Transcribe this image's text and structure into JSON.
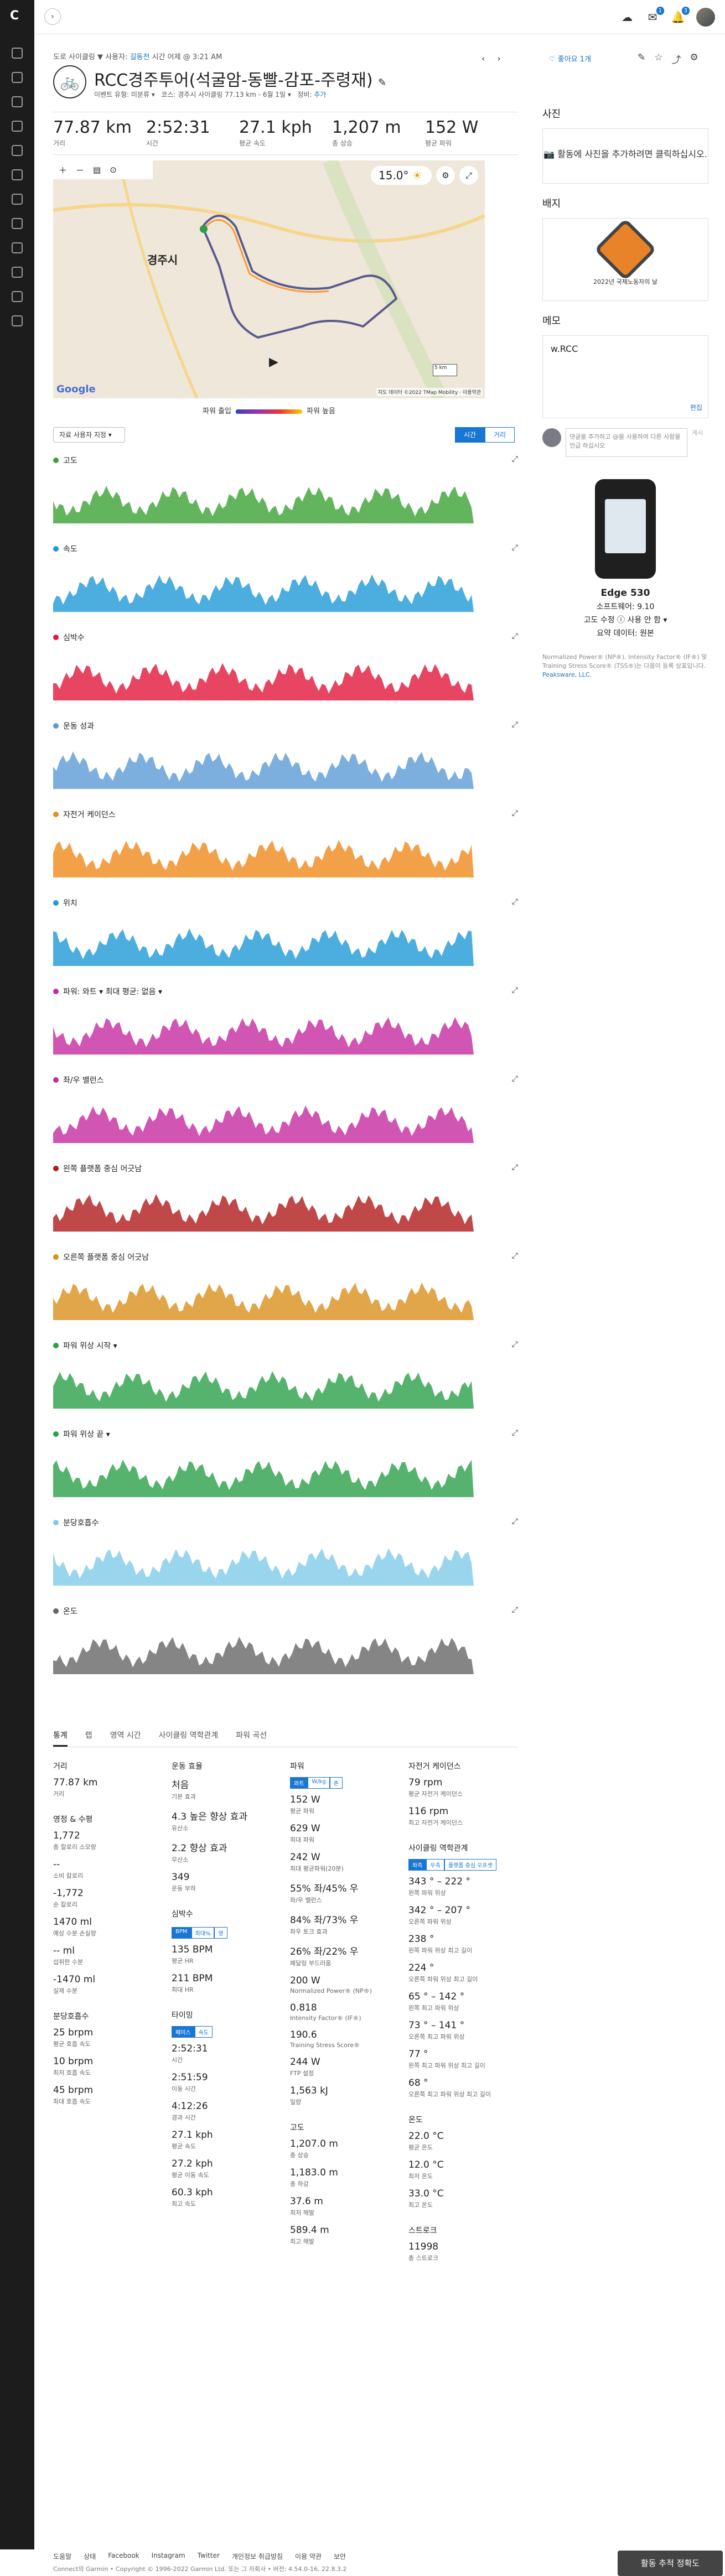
{
  "nav": {
    "logo": "C"
  },
  "breadcrumb": {
    "prefix": "도로 사이클링",
    "sep": "▼",
    "by": "사용자:",
    "user": "길동천",
    "when": "시간 어제 @ 3:21 AM"
  },
  "activity": {
    "title": "RCC경주투어(석굴암-동빨-감포-주령재)",
    "edit_icon": "pencil-icon",
    "sub_event": "이벤트 유형: 미분류 ▾",
    "sub_course": "코스: 경주시 사이클링 77.13 km - 6월 1일 ▾",
    "sub_privacy": "정비:",
    "sub_privacy_val": "추가",
    "like": "좋아요 1개"
  },
  "stats": [
    {
      "value": "77.87 km",
      "label": "거리"
    },
    {
      "value": "2:52:31",
      "label": "시간"
    },
    {
      "value": "27.1 kph",
      "label": "평균 속도"
    },
    {
      "value": "1,207 m",
      "label": "총 상승"
    },
    {
      "value": "152 W",
      "label": "평균 파워"
    }
  ],
  "map": {
    "city": "경주시",
    "deg": "15.0°",
    "credit": "지도 데이터 ©2022 TMap Mobility · 이용약관",
    "scale": "5 km",
    "google": "Google"
  },
  "legend": {
    "left": "파워 출입",
    "right": "파워 높음"
  },
  "overlay": {
    "label": "자료 사용자 지정 ▾"
  },
  "seg": {
    "a": "시간",
    "b": "거리"
  },
  "charts": [
    {
      "title": "고도",
      "color": "#3ba233"
    },
    {
      "title": "속도",
      "color": "#1e9ad6"
    },
    {
      "title": "심박수",
      "color": "#e2173c"
    },
    {
      "title": "운동 성과",
      "color": "#5b9bd5"
    },
    {
      "title": "자전거 케이던스",
      "color": "#ef8a1c"
    },
    {
      "title": "위치",
      "color": "#1e9ad6"
    },
    {
      "title": "파워: 와트 ▾   최대 평균: 없음 ▾",
      "color": "#c62aa0"
    },
    {
      "title": "좌/우 밸런스",
      "color": "#c62aa0"
    },
    {
      "title": "왼쪽 플랫폼 중심 어긋남",
      "color": "#b01a1a"
    },
    {
      "title": "오른쪽 플랫폼 중심 어긋남",
      "color": "#d9901b"
    },
    {
      "title": "파워 위상 시작 ▾",
      "color": "#2aa04a"
    },
    {
      "title": "파워 위상 끝 ▾",
      "color": "#2aa04a"
    },
    {
      "title": "분당호흡수",
      "color": "#7fcbe8"
    },
    {
      "title": "온도",
      "color": "#666666"
    }
  ],
  "tabs": [
    "통계",
    "랩",
    "영역 시간",
    "사이클링 역학관계",
    "파워 곡선"
  ],
  "col1": [
    {
      "h": "거리",
      "items": [
        {
          "v": "77.87 km",
          "l": "거리"
        }
      ]
    },
    {
      "h": "영정 & 수평",
      "items": [
        {
          "v": "1,772",
          "l": "총 칼로리 소모량"
        },
        {
          "v": "--",
          "l": "소비 칼로리"
        },
        {
          "v": "-1,772",
          "l": "순 칼로리"
        },
        {
          "v": "1470 ml",
          "l": "예상 수분 손실량"
        },
        {
          "v": "-- ml",
          "l": "섭취한 수분"
        },
        {
          "v": "-1470 ml",
          "l": "실제 수분"
        }
      ]
    },
    {
      "h": "분당호흡수",
      "items": [
        {
          "v": "25 brpm",
          "l": "평균 호흡 속도"
        },
        {
          "v": "10 brpm",
          "l": "최저 호흡 속도"
        },
        {
          "v": "45 brpm",
          "l": "최대 호흡 속도"
        }
      ]
    }
  ],
  "col2": [
    {
      "h": "운동 효율",
      "items": [
        {
          "v": "처음",
          "l": "기본 효과"
        },
        {
          "v": "4.3 높은 향상 효과",
          "l": "유산소"
        },
        {
          "v": "2.2 향상 효과",
          "l": "무산소"
        },
        {
          "v": "349",
          "l": "운동 부하"
        }
      ]
    },
    {
      "h": "심박수",
      "pill": [
        "BPM",
        "최대%",
        "영"
      ],
      "items": [
        {
          "v": "135 BPM",
          "l": "평균 HR"
        },
        {
          "v": "211 BPM",
          "l": "최대 HR"
        }
      ]
    },
    {
      "h": "타이밍",
      "pill": [
        "페이스",
        "속도"
      ],
      "items": [
        {
          "v": "2:52:31",
          "l": "시간"
        },
        {
          "v": "2:51:59",
          "l": "이동 시간"
        },
        {
          "v": "4:12:26",
          "l": "경과 시간"
        },
        {
          "v": "27.1 kph",
          "l": "평균 속도"
        },
        {
          "v": "27.2 kph",
          "l": "평균 이동 속도"
        },
        {
          "v": "60.3 kph",
          "l": "최고 속도"
        }
      ]
    }
  ],
  "col3": [
    {
      "h": "파워",
      "pill": [
        "와트",
        "W/kg",
        "존"
      ],
      "items": [
        {
          "v": "152 W",
          "l": "평균 파워"
        },
        {
          "v": "629 W",
          "l": "최대 파워"
        },
        {
          "v": "242 W",
          "l": "최대 평균파워(20분)"
        },
        {
          "v": "55% 좌/45% 우",
          "l": "좌/우 밸런스"
        },
        {
          "v": "84% 좌/73% 우",
          "l": "좌우 토크 효과"
        },
        {
          "v": "26% 좌/22% 우",
          "l": "페달링 부드러움"
        },
        {
          "v": "200 W",
          "l": "Normalized Power® (NP®)"
        },
        {
          "v": "0.818",
          "l": "Intensity Factor® (IF®)"
        },
        {
          "v": "190.6",
          "l": "Training Stress Score®"
        },
        {
          "v": "244 W",
          "l": "FTP 설정"
        },
        {
          "v": "1,563 kJ",
          "l": "일량"
        }
      ]
    },
    {
      "h": "고도",
      "items": [
        {
          "v": "1,207.0 m",
          "l": "총 상승"
        },
        {
          "v": "1,183.0 m",
          "l": "총 하강"
        },
        {
          "v": "37.6 m",
          "l": "최저 해발"
        },
        {
          "v": "589.4 m",
          "l": "최고 해발"
        }
      ]
    }
  ],
  "col4": [
    {
      "h": "자전거 케이던스",
      "items": [
        {
          "v": "79 rpm",
          "l": "평균 자전거 케이던스"
        },
        {
          "v": "116 rpm",
          "l": "최고 자전거 케이던스"
        }
      ]
    },
    {
      "h": "사이클링 역학관계",
      "pill": [
        "좌측",
        "우측",
        "플랫폼 중심 오프셋"
      ],
      "items": [
        {
          "v": "343 ° – 222 °",
          "l": "왼쪽 파워 위상"
        },
        {
          "v": "342 ° – 207 °",
          "l": "오른쪽 파워 위상"
        },
        {
          "v": "238 °",
          "l": "왼쪽 파워 위상 최고 길이"
        },
        {
          "v": "224 °",
          "l": "오른쪽 파워 위상 최고 길이"
        },
        {
          "v": "65 ° – 142 °",
          "l": "왼쪽 최고 파워 위상"
        },
        {
          "v": "73 ° – 141 °",
          "l": "오른쪽 최고 파워 위상"
        },
        {
          "v": "77 °",
          "l": "왼쪽 최고 파워 위상 최고 길이"
        },
        {
          "v": "68 °",
          "l": "오른쪽 최고 파워 위상 최고 길이"
        }
      ]
    },
    {
      "h": "온도",
      "items": [
        {
          "v": "22.0 °C",
          "l": "평균 온도"
        },
        {
          "v": "12.0 °C",
          "l": "최저 온도"
        },
        {
          "v": "33.0 °C",
          "l": "최고 온도"
        }
      ]
    },
    {
      "h": "스트로크",
      "items": [
        {
          "v": "11998",
          "l": "총 스트로크"
        }
      ]
    }
  ],
  "right": {
    "photos_h": "사진",
    "photos_cta": "활동에 사진을 추가하려면 클릭하십시오.",
    "badges_h": "배지",
    "badge_name": "2022년 국제노동자의 날",
    "memo_h": "메모",
    "memo_text": "w.RCC",
    "memo_edit": "편집",
    "comment_ph": "댓글을 추가하고 @을 사용하여 다른 사람을 언급 하십시오",
    "comment_btn": "게시",
    "device_name": "Edge 530",
    "device_sw": "소프트웨어: 9.10",
    "device_elev": "고도 수정 ⓘ 사용 안 함 ▾",
    "device_summary": "요약 데이터: 원본",
    "fine": "Normalized Power® (NP®), Intensity Factor® (IF®) 및 Training Stress Score® (TSS®)는 다음이 등록 상표입니다.",
    "fine_link": "Peaksware, LLC."
  },
  "footer": {
    "links": [
      "도움말",
      "상태",
      "Facebook",
      "Instagram",
      "Twitter",
      "개인정보 취급방침",
      "이용 약관",
      "보안"
    ],
    "copy": "Connect의 Garmin • Copyright © 1996-2022 Garmin Ltd. 또는 그 자회사 • 버전: 4.54.0-16, 22.8.3.2",
    "feedback": "활동 추적 정확도"
  },
  "colors": {
    "accent": "#1976d2",
    "sidebar": "#1c1c1c"
  }
}
